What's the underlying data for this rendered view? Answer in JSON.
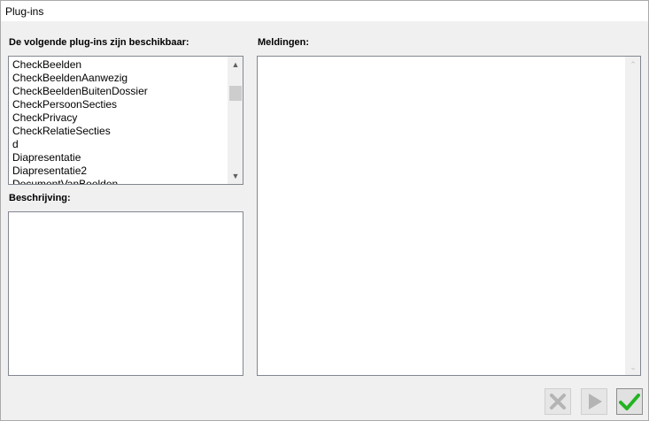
{
  "window": {
    "title": "Plug-ins"
  },
  "plugins": {
    "label": "De volgende plug-ins zijn beschikbaar:",
    "items": [
      "CheckBeelden",
      "CheckBeeldenAanwezig",
      "CheckBeeldenBuitenDossier",
      "CheckPersoonSecties",
      "CheckPrivacy",
      "CheckRelatieSecties",
      "d",
      "Diapresentatie",
      "Diapresentatie2",
      "DocumentVanBeelden"
    ]
  },
  "description": {
    "label": "Beschrijving:",
    "text": ""
  },
  "messages": {
    "label": "Meldingen:",
    "text": ""
  },
  "buttons": {
    "cancel_icon": "x-icon",
    "run_icon": "play-icon",
    "ok_icon": "checkmark-icon"
  },
  "colors": {
    "ok_green": "#22b422",
    "disabled_gray": "#b4b4b4"
  }
}
